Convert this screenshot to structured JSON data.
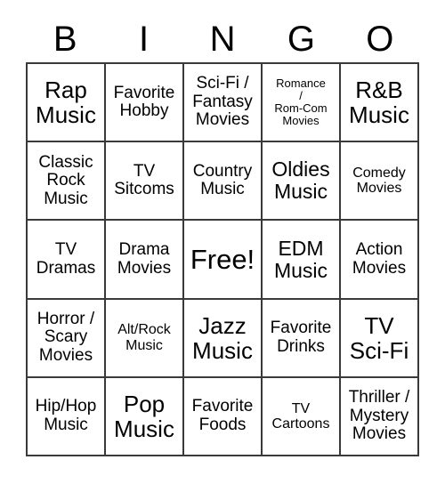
{
  "card": {
    "header_letters": [
      "B",
      "I",
      "N",
      "G",
      "O"
    ],
    "free_space_label": "Free!",
    "colors": {
      "background": "#ffffff",
      "text": "#000000",
      "grid_line": "#3a3a3a"
    },
    "rows": [
      [
        {
          "text": "Rap\nMusic",
          "size": "xl"
        },
        {
          "text": "Favorite\nHobby",
          "size": "md"
        },
        {
          "text": "Sci-Fi /\nFantasy\nMovies",
          "size": "md"
        },
        {
          "text": "Romance\n/\nRom-Com\nMovies",
          "size": "xs"
        },
        {
          "text": "R&B\nMusic",
          "size": "xl"
        }
      ],
      [
        {
          "text": "Classic\nRock\nMusic",
          "size": "md"
        },
        {
          "text": "TV\nSitcoms",
          "size": "md"
        },
        {
          "text": "Country\nMusic",
          "size": "md"
        },
        {
          "text": "Oldies\nMusic",
          "size": "lg"
        },
        {
          "text": "Comedy\nMovies",
          "size": "sm"
        }
      ],
      [
        {
          "text": "TV\nDramas",
          "size": "md"
        },
        {
          "text": "Drama\nMovies",
          "size": "md"
        },
        {
          "text": "Free!",
          "size": "xxl"
        },
        {
          "text": "EDM\nMusic",
          "size": "lg"
        },
        {
          "text": "Action\nMovies",
          "size": "md"
        }
      ],
      [
        {
          "text": "Horror /\nScary\nMovies",
          "size": "md"
        },
        {
          "text": "Alt/Rock\nMusic",
          "size": "sm"
        },
        {
          "text": "Jazz\nMusic",
          "size": "xl"
        },
        {
          "text": "Favorite\nDrinks",
          "size": "md"
        },
        {
          "text": "TV\nSci-Fi",
          "size": "xl"
        }
      ],
      [
        {
          "text": "Hip/Hop\nMusic",
          "size": "md"
        },
        {
          "text": "Pop\nMusic",
          "size": "xl"
        },
        {
          "text": "Favorite\nFoods",
          "size": "md"
        },
        {
          "text": "TV\nCartoons",
          "size": "sm"
        },
        {
          "text": "Thriller /\nMystery\nMovies",
          "size": "md"
        }
      ]
    ]
  }
}
